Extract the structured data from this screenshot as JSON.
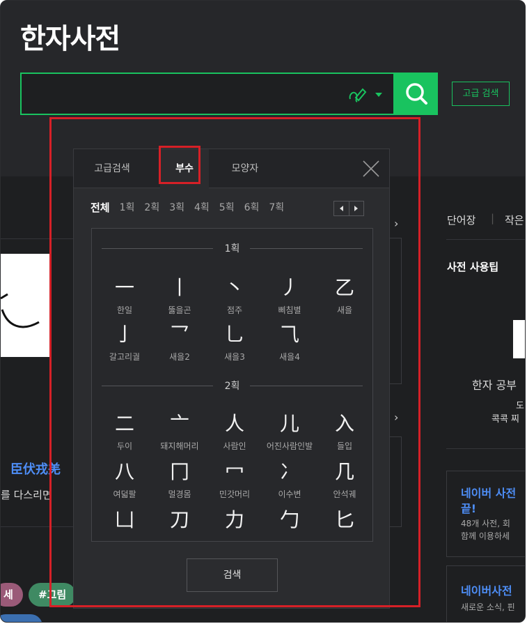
{
  "header": {
    "title": "한자사전",
    "search_placeholder": "",
    "adv_search_label": "고급 검색"
  },
  "background": {
    "right_nav": [
      "단어장",
      "작은"
    ],
    "tip_title": "사전 사용팁",
    "study_text": "한자 공부",
    "sub_text_1": "도",
    "sub_text_2": "콕콕 찌",
    "hanja_phrase": "臣伏戎羌",
    "phrase_text": "를 다스리면",
    "card1_title": "네이버 사전",
    "card1_title_2": "끝!",
    "card1_line1": "48개 사전, 회",
    "card1_line2": "함께 이용하세",
    "card2_title": "네이버사전",
    "card2_line1": "새로운 소식, 핀",
    "tag1": "세",
    "tag2": "#그림"
  },
  "popup": {
    "tabs": [
      {
        "label": "고급검색"
      },
      {
        "label": "부수"
      },
      {
        "label": "모양자"
      }
    ],
    "strokes": [
      "전체",
      "1획",
      "2획",
      "3획",
      "4획",
      "5획",
      "6획",
      "7획"
    ],
    "sections": [
      {
        "label": "1획",
        "items": [
          {
            "ch": "一",
            "name": "한일"
          },
          {
            "ch": "丨",
            "name": "뚫을곤"
          },
          {
            "ch": "丶",
            "name": "점주"
          },
          {
            "ch": "丿",
            "name": "삐침별"
          },
          {
            "ch": "乙",
            "name": "새을"
          },
          {
            "ch": "亅",
            "name": "갈고리궐"
          },
          {
            "ch": "乛",
            "name": "새을2"
          },
          {
            "ch": "乚",
            "name": "새을3"
          },
          {
            "ch": "⺄",
            "name": "새을4"
          }
        ]
      },
      {
        "label": "2획",
        "items": [
          {
            "ch": "二",
            "name": "두이"
          },
          {
            "ch": "亠",
            "name": "돼지해머리"
          },
          {
            "ch": "人",
            "name": "사람인"
          },
          {
            "ch": "儿",
            "name": "어진사람인발"
          },
          {
            "ch": "入",
            "name": "들입"
          },
          {
            "ch": "八",
            "name": "여덟팔"
          },
          {
            "ch": "冂",
            "name": "멀경몸"
          },
          {
            "ch": "冖",
            "name": "민갓머리"
          },
          {
            "ch": "冫",
            "name": "이수변"
          },
          {
            "ch": "几",
            "name": "안석궤"
          },
          {
            "ch": "凵",
            "name": ""
          },
          {
            "ch": "刀",
            "name": ""
          },
          {
            "ch": "力",
            "name": ""
          },
          {
            "ch": "勹",
            "name": ""
          },
          {
            "ch": "匕",
            "name": ""
          }
        ]
      }
    ],
    "submit_label": "검색"
  },
  "colors": {
    "accent": "#19c35f",
    "highlight": "#d62027",
    "background": "#1e1f21"
  }
}
